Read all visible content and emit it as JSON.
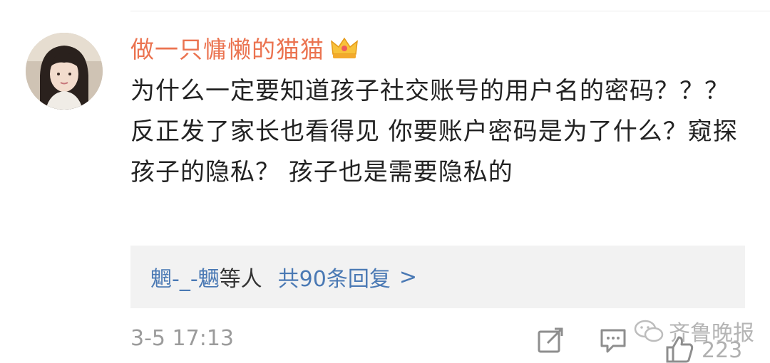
{
  "comment": {
    "username": "做一只慵懒的猫猫",
    "text": "为什么一定要知道孩子社交账号的用户名的密码？？？ 反正发了家长也看得见 你要账户密码是为了什么？窥探孩子的隐私？ 孩子也是需要隐私的",
    "timestamp": "3-5 17:13",
    "like_count": "223"
  },
  "replies": {
    "users": "魍-_-魉",
    "users_suffix": "等人",
    "count_label": "共90条回复",
    "chevron": ">"
  },
  "watermark": {
    "text": "齐鲁晚报"
  },
  "icons": {
    "badge": "crown-icon",
    "share": "share-icon",
    "comment": "comment-icon",
    "like": "like-icon",
    "watermark": "wechat-icon"
  },
  "colors": {
    "username": "#eb7350",
    "link": "#4a79b4",
    "text": "#222222",
    "muted": "#9b9b9b",
    "reply_bg": "#f2f2f2"
  }
}
